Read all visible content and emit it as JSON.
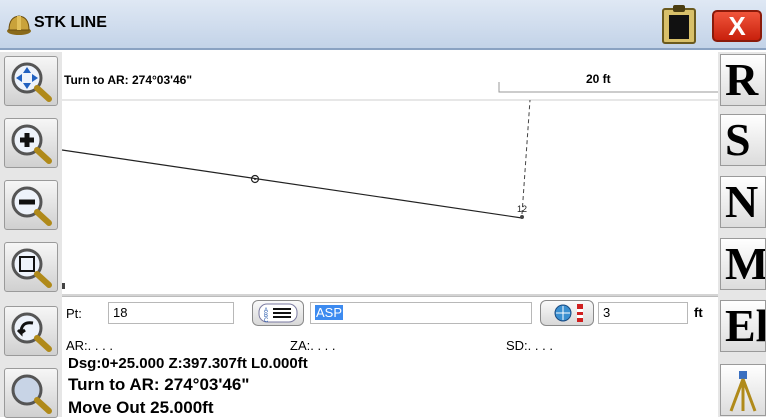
{
  "title": "STK LINE",
  "plot": {
    "turn_label": "Turn to AR: 274°03'46\"",
    "scale_label": "20 ft",
    "point_label": "12"
  },
  "form": {
    "pt_label": "Pt:",
    "pt_value": "18",
    "code_value": "ASP",
    "height_value": "3",
    "height_unit": "ft",
    "ar_label": "AR:. . . .",
    "za_label": "ZA:. . . .",
    "sd_label": "SD:. . . .",
    "dsg_line": "Dsg:0+25.000 Z:397.307ft L0.000ft",
    "turn_line": "Turn to AR: 274°03'46\"",
    "move_line": "Move Out 25.000ft"
  },
  "close_label": "X",
  "right_toolbar": [
    "R",
    "S",
    "N",
    "M",
    "El"
  ],
  "left_toolbar_icons": [
    "pan-zoom-icon",
    "zoom-in-icon",
    "zoom-out-icon",
    "zoom-extents-icon",
    "zoom-previous-icon",
    "zoom-window-icon"
  ],
  "colors": {
    "titlebar": "#c3d3e8",
    "close": "#d9300f",
    "highlight": "#3d8bf0"
  }
}
